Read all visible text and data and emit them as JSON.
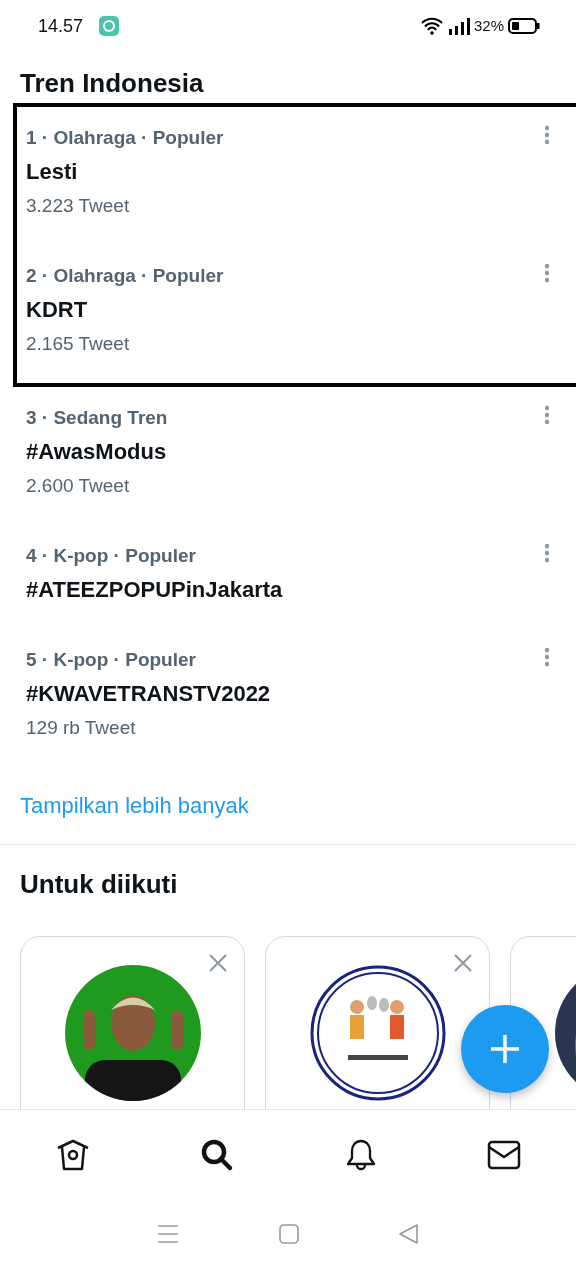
{
  "status_bar": {
    "time": "14.57",
    "battery": "32%"
  },
  "section_title": "Tren Indonesia",
  "trends": [
    {
      "meta": "1 · Olahraga · Populer",
      "title": "Lesti",
      "count": "3.223 Tweet",
      "highlighted": true
    },
    {
      "meta": "2 · Olahraga · Populer",
      "title": "KDRT",
      "count": "2.165 Tweet",
      "highlighted": true
    },
    {
      "meta": "3 · Sedang Tren",
      "title": "#AwasModus",
      "count": "2.600 Tweet",
      "highlighted": false
    },
    {
      "meta": "4 · K-pop · Populer",
      "title": "#ATEEZPOPUPinJakarta",
      "highlighted": false
    },
    {
      "meta": "5 · K-pop · Populer",
      "title": "#KWAVETRANSTV2022",
      "count": "129 rb Tweet",
      "highlighted": false
    }
  ],
  "show_more": "Tampilkan lebih banyak",
  "follow_title": "Untuk diikuti",
  "bottom_nav": [
    {
      "kind": "home",
      "selected": false
    },
    {
      "kind": "search",
      "selected": true
    },
    {
      "kind": "bell",
      "selected": false
    },
    {
      "kind": "mail",
      "selected": false
    }
  ]
}
